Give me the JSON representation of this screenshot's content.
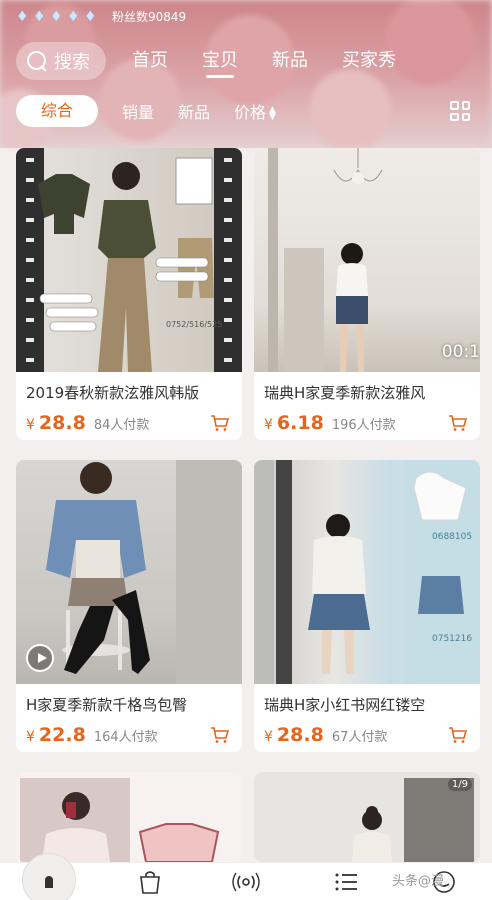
{
  "header": {
    "diamond_count": 5,
    "fans_label": "粉丝数90849",
    "search_label": "搜索",
    "nav_tabs": [
      {
        "label": "首页",
        "active": false
      },
      {
        "label": "宝贝",
        "active": true
      },
      {
        "label": "新品",
        "active": false
      },
      {
        "label": "买家秀",
        "active": false
      }
    ]
  },
  "sort_bar": {
    "active_label": "综合",
    "items": [
      "销量",
      "新品",
      "价格"
    ],
    "price_sort_icon": "up-down-arrows",
    "view_toggle_icon": "grid-icon"
  },
  "products": [
    {
      "title": "2019春秋新款泫雅风韩版",
      "price_symbol": "¥",
      "price": "28.8",
      "sold": "84人付款",
      "image_labels": [
        "0752/516/525"
      ]
    },
    {
      "title": "瑞典H家夏季新款泫雅风",
      "price_symbol": "¥",
      "price": "6.18",
      "sold": "196人付款",
      "video_duration": "00:1"
    },
    {
      "title": "H家夏季新款千格鸟包臀",
      "price_symbol": "¥",
      "price": "22.8",
      "sold": "164人付款",
      "has_play": true
    },
    {
      "title": "瑞典H家小红书网红镂空",
      "price_symbol": "¥",
      "price": "28.8",
      "sold": "67人付款",
      "image_labels": [
        "0688105",
        "0751216"
      ]
    }
  ],
  "partial_row": {
    "page_indicator": "1/9"
  },
  "bottom_bar": {
    "icons": [
      "avatar",
      "bag-icon",
      "live-icon",
      "list-icon",
      "service-icon"
    ]
  },
  "watermark": "头条@漫"
}
